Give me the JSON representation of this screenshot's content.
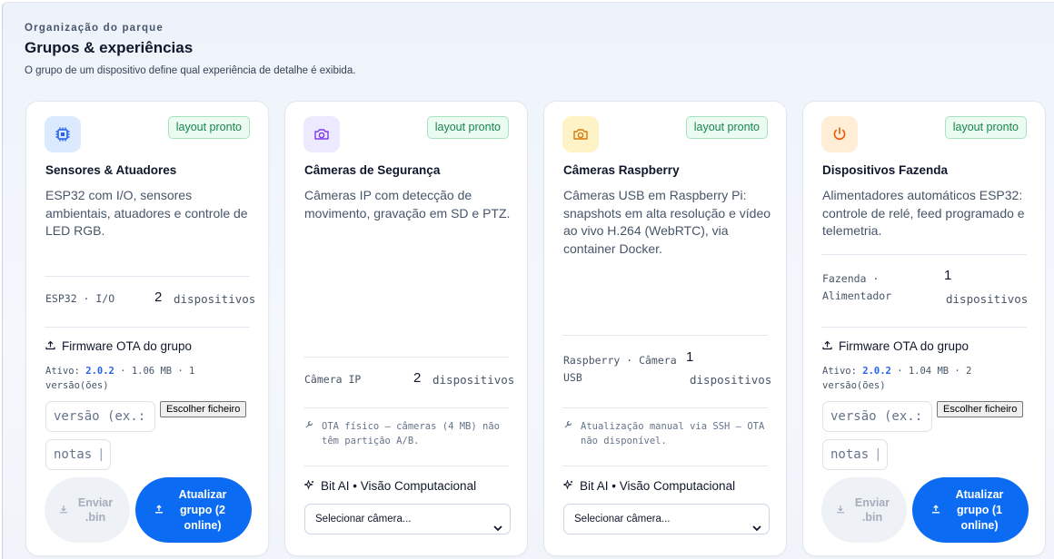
{
  "header": {
    "eyebrow": "Organização do parque",
    "title": "Grupos & experiências",
    "subtitle": "O grupo de um dispositivo define qual experiência de detalhe é exibida."
  },
  "colors": {
    "accent": "#0b6cf3",
    "badge_green": "#16864a",
    "sensors_icon_bg": "#dbeafe",
    "security_icon_bg": "#ede9fe",
    "raspberry_icon_bg": "#fef3c7",
    "farm_icon_bg": "#ffedd5"
  },
  "cards": [
    {
      "icon": "chip-icon",
      "badge": "layout pronto",
      "name": "Sensores & Atuadores",
      "description": "ESP32 com I/O, sensores ambientais, atuadores e controle de LED RGB.",
      "stat_label": "ESP32 · I/O",
      "stat_count": "2",
      "stat_unit": "dispositivos",
      "ota": {
        "title": "Firmware OTA do grupo",
        "info_prefix": "Ativo: ",
        "version": "2.0.2",
        "info_suffix": " · 1.06 MB · 1 versão(ões)",
        "version_placeholder": "versão (ex.:",
        "notes_placeholder": "notas",
        "file_button": "Escolher ficheiro",
        "send_label": "Enviar .bin",
        "update_label": "Atualizar grupo (2 online)"
      }
    },
    {
      "icon": "camera-icon",
      "badge": "layout pronto",
      "name": "Câmeras de Segurança",
      "description": "Câmeras IP com detecção de movimento, gravação em SD e PTZ.",
      "stat_label": "Câmera IP",
      "stat_count": "2",
      "stat_unit": "dispositivos",
      "note": "OTA físico — câmeras (4 MB) não têm partição A/B.",
      "ai_title": "Bit AI • Visão Computacional",
      "select_label": "Selecionar câmera..."
    },
    {
      "icon": "camera-icon",
      "badge": "layout pronto",
      "name": "Câmeras Raspberry",
      "description": "Câmeras USB em Raspberry Pi: snapshots em alta resolução e vídeo ao vivo H.264 (WebRTC), via container Docker.",
      "stat_label": "Raspberry · Câmera USB",
      "stat_count": "1",
      "stat_unit": "dispositivos",
      "note": "Atualização manual via SSH — OTA não disponível.",
      "ai_title": "Bit AI • Visão Computacional",
      "select_label": "Selecionar câmera..."
    },
    {
      "icon": "power-icon",
      "badge": "layout pronto",
      "name": "Dispositivos Fazenda",
      "description": "Alimentadores automáticos ESP32: controle de relé, feed programado e telemetria.",
      "stat_label": "Fazenda · Alimentador",
      "stat_count": "1",
      "stat_unit": "dispositivos",
      "ota": {
        "title": "Firmware OTA do grupo",
        "info_prefix": "Ativo: ",
        "version": "2.0.2",
        "info_suffix": " · 1.04 MB · 2 versão(ões)",
        "version_placeholder": "versão (ex.:",
        "notes_placeholder": "notas",
        "file_button": "Escolher ficheiro",
        "send_label": "Enviar .bin",
        "update_label": "Atualizar grupo (1 online)"
      }
    }
  ]
}
